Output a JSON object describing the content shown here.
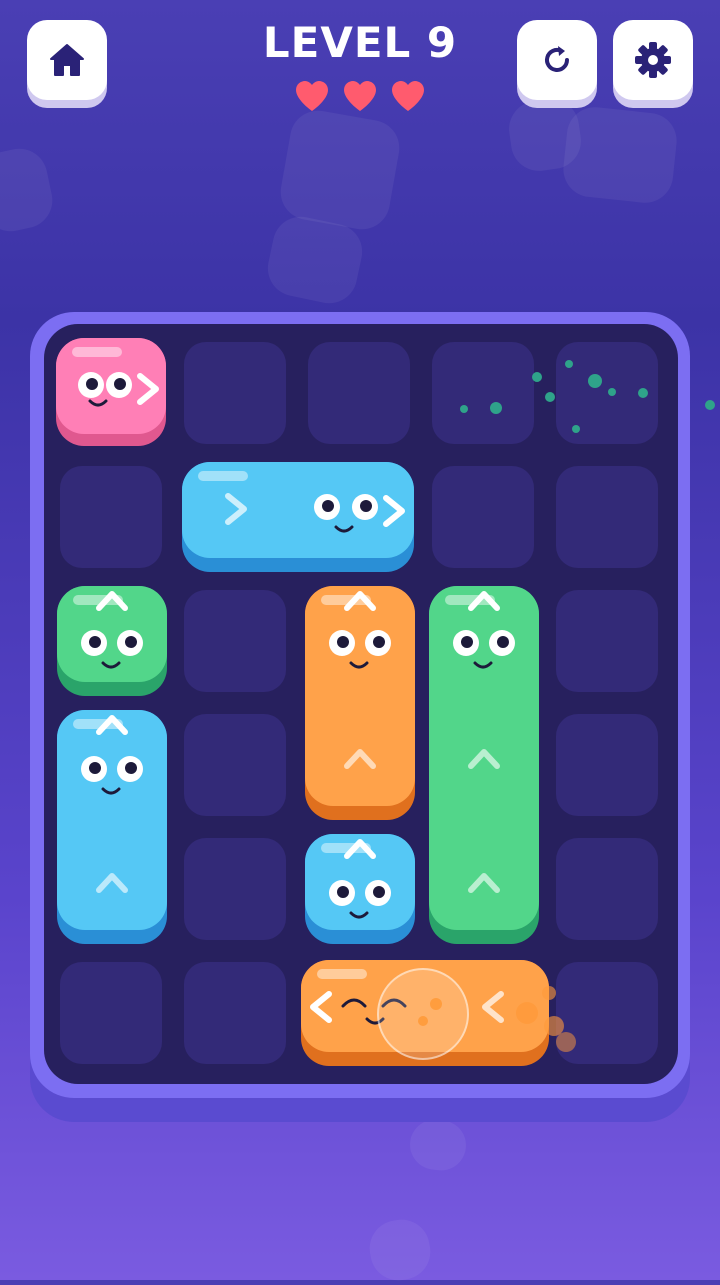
{
  "header": {
    "title": "LEVEL 9",
    "lives": 3
  },
  "buttons": {
    "home": "home-icon",
    "restart": "restart-icon",
    "settings": "gear-icon"
  },
  "board": {
    "rows": 6,
    "cols": 5
  },
  "blocks": [
    {
      "color": "pink",
      "orientation": "horizontal",
      "direction": "right",
      "col": 0,
      "row": 0,
      "length": 1
    },
    {
      "color": "blue",
      "orientation": "horizontal",
      "direction": "right",
      "col": 1,
      "row": 1,
      "length": 2
    },
    {
      "color": "green",
      "orientation": "vertical",
      "direction": "up",
      "col": 0,
      "row": 2,
      "length": 1
    },
    {
      "color": "orange",
      "orientation": "vertical",
      "direction": "up",
      "col": 2,
      "row": 2,
      "length": 2
    },
    {
      "color": "green",
      "orientation": "vertical",
      "direction": "up",
      "col": 3,
      "row": 2,
      "length": 3
    },
    {
      "color": "blue",
      "orientation": "vertical",
      "direction": "up",
      "col": 0,
      "row": 3,
      "length": 2
    },
    {
      "color": "blue",
      "orientation": "vertical",
      "direction": "up",
      "col": 2,
      "row": 4,
      "length": 1
    },
    {
      "color": "orange",
      "orientation": "horizontal",
      "direction": "left",
      "col": 2,
      "row": 5,
      "length": 2
    }
  ],
  "colors": {
    "pink": "#ff7fb6",
    "blue": "#55c8f5",
    "green": "#52d68a",
    "orange": "#ffa24a",
    "heart": "#ff5b6e"
  }
}
